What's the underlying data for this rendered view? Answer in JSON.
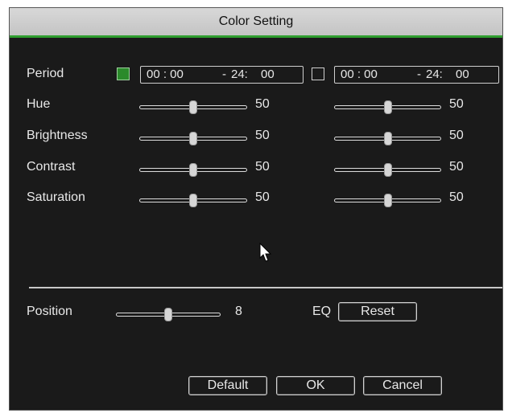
{
  "title": "Color Setting",
  "period": {
    "label": "Period",
    "slot1": {
      "checked": true,
      "start": "00 : 00",
      "dash": "-",
      "end_h": "24:",
      "end_m": "00"
    },
    "slot2": {
      "checked": false,
      "start": "00 : 00",
      "dash": "-",
      "end_h": "24:",
      "end_m": "00"
    }
  },
  "sliders": [
    {
      "label": "Hue",
      "left_value": "50",
      "right_value": "50",
      "left_level": 0.5,
      "right_level": 0.5
    },
    {
      "label": "Brightness",
      "left_value": "50",
      "right_value": "50",
      "left_level": 0.5,
      "right_level": 0.5
    },
    {
      "label": "Contrast",
      "left_value": "50",
      "right_value": "50",
      "left_level": 0.5,
      "right_level": 0.5
    },
    {
      "label": "Saturation",
      "left_value": "50",
      "right_value": "50",
      "left_level": 0.5,
      "right_level": 0.5
    }
  ],
  "position": {
    "label": "Position",
    "value": "8",
    "level": 0.5
  },
  "eq": {
    "label": "EQ",
    "button": "Reset"
  },
  "buttons": {
    "default": "Default",
    "ok": "OK",
    "cancel": "Cancel"
  },
  "colors": {
    "accent": "#2f9e2f",
    "background": "#1a1a1a",
    "text": "#e8e8e8"
  }
}
